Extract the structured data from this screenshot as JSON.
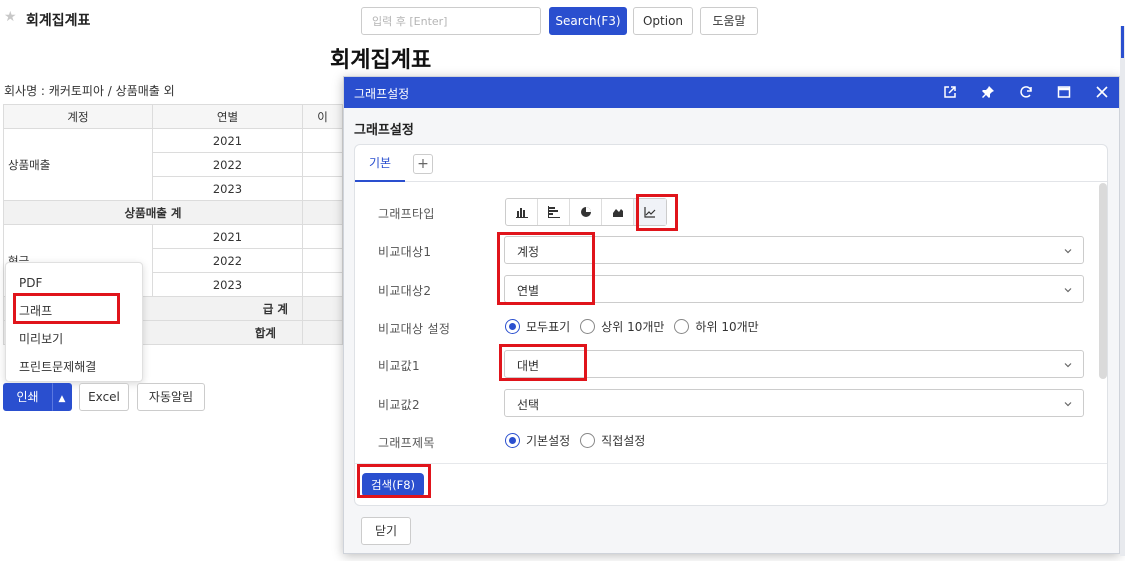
{
  "header": {
    "page_name": "회계집계표",
    "search_placeholder": "입력 후 [Enter]",
    "search_btn": "Search(F3)",
    "option_btn": "Option",
    "help_btn": "도움말"
  },
  "report": {
    "title": "회계집계표",
    "company": "회사명 : 캐커토피아 / 상품매출 외",
    "columns": [
      "계정",
      "연별",
      "이"
    ],
    "groups": [
      {
        "account": "상품매출",
        "years": [
          "2021",
          "2022",
          "2023"
        ],
        "subtotal": "상품매출 계"
      },
      {
        "account": "현금",
        "years": [
          "2021",
          "2022",
          "2023"
        ],
        "subtotal": "급 계"
      }
    ],
    "grand_total": "합계"
  },
  "print_menu": {
    "items": [
      "PDF",
      "그래프",
      "미리보기",
      "프린트문제해결"
    ]
  },
  "toolbar": {
    "print_btn": "인쇄",
    "excel_btn": "Excel",
    "auto_alarm_btn": "자동알림"
  },
  "dialog": {
    "title": "그래프설정",
    "section_title": "그래프설정",
    "tab_basic": "기본",
    "tab_add": "+",
    "labels": {
      "graph_type": "그래프타입",
      "compare1": "비교대상1",
      "compare2": "비교대상2",
      "compare_setting": "비교대상 설정",
      "value1": "비교값1",
      "value2": "비교값2",
      "graph_title": "그래프제목"
    },
    "values": {
      "compare1": "계정",
      "compare2": "연별",
      "value1": "대변",
      "value2": "선택"
    },
    "compare_options": [
      "모두표기",
      "상위 10개만",
      "하위 10개만"
    ],
    "title_options": [
      "기본설정",
      "직접설정"
    ],
    "search_btn": "검색(F8)",
    "close_btn": "닫기"
  },
  "colors": {
    "primary": "#2a4fcf",
    "highlight": "#e0141b"
  }
}
